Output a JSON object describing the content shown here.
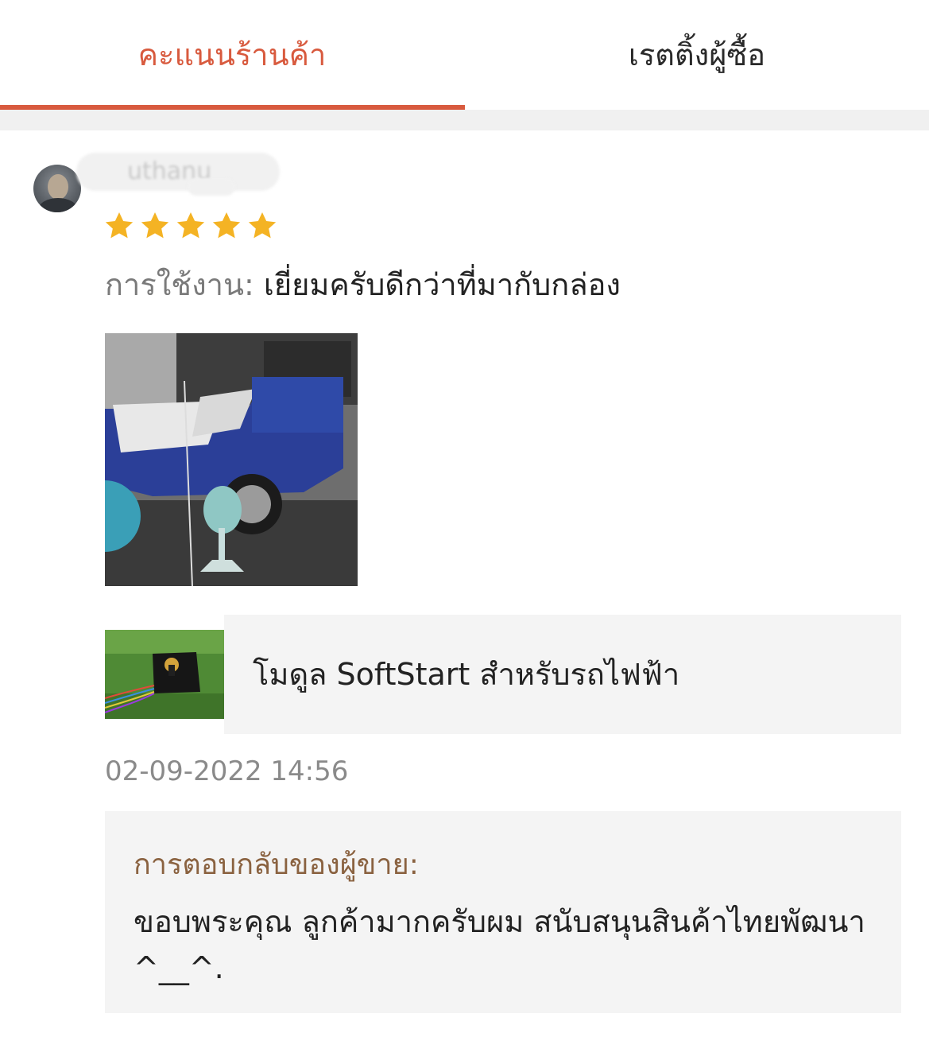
{
  "tabs": {
    "shop_rating": "คะแนนร้านค้า",
    "buyer_rating": "เรตติ้งผู้ซื้อ",
    "active_color": "#d85a3e"
  },
  "review": {
    "username": "uthanu",
    "rating": 5,
    "rating_max": 5,
    "star_color": "#f4b324",
    "usage_label": "การใช้งาน: ",
    "usage_value": "เยี่ยมครับดีกว่าที่มากับกล่อง",
    "photo_icon": "review-photo-vehicle",
    "product": {
      "name": "โมดูล SoftStart สำหรับรถไฟฟ้า",
      "thumb_icon": "product-thumbnail-module"
    },
    "timestamp": "02-09-2022 14:56",
    "seller_reply": {
      "title": "การตอบกลับของผู้ขาย:",
      "text": "ขอบพระคุณ ลูกค้ามากครับผม สนับสนุนสินค้าไทยพัฒนา ^__^."
    }
  }
}
